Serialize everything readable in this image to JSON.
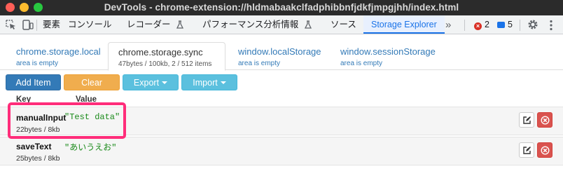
{
  "window": {
    "title": "DevTools - chrome-extension://hldmabaakclfadphibbnfjdkfjmpgjhh/index.html"
  },
  "devtools_tabs": [
    {
      "label": "要素"
    },
    {
      "label": "コンソール"
    },
    {
      "label": "レコーダー"
    },
    {
      "label": "パフォーマンス分析情報"
    },
    {
      "label": "ソース"
    },
    {
      "label": "Storage Explorer"
    },
    {
      "label": "»"
    }
  ],
  "status": {
    "error_count": "2",
    "message_count": "5"
  },
  "storage_tabs": [
    {
      "title": "chrome.storage.local",
      "subtitle": "area is empty"
    },
    {
      "title": "chrome.storage.sync",
      "subtitle": "47bytes / 100kb, 2 / 512 items"
    },
    {
      "title": "window.localStorage",
      "subtitle": "area is empty"
    },
    {
      "title": "window.sessionStorage",
      "subtitle": "area is empty"
    }
  ],
  "toolbar": {
    "add_label": "Add Item",
    "clear_label": "Clear",
    "export_label": "Export",
    "import_label": "Import"
  },
  "columns": {
    "key": "Key",
    "value": "Value"
  },
  "items": [
    {
      "key": "manualInput",
      "value": "\"Test data\"",
      "size": "22bytes / 8kb"
    },
    {
      "key": "saveText",
      "value": "\"あいうえお\"",
      "size": "25bytes / 8kb"
    }
  ],
  "colors": {
    "accent": "#1a73e8",
    "link": "#337ab7",
    "highlight": "#ff2d7a",
    "value_text": "#1a8a1a"
  },
  "icons": [
    "inspect-element-icon",
    "device-toolbar-icon",
    "flask-icon",
    "more-tabs-icon",
    "error-icon",
    "message-icon",
    "settings-gear-icon",
    "kebab-menu-icon",
    "edit-icon",
    "delete-icon"
  ]
}
